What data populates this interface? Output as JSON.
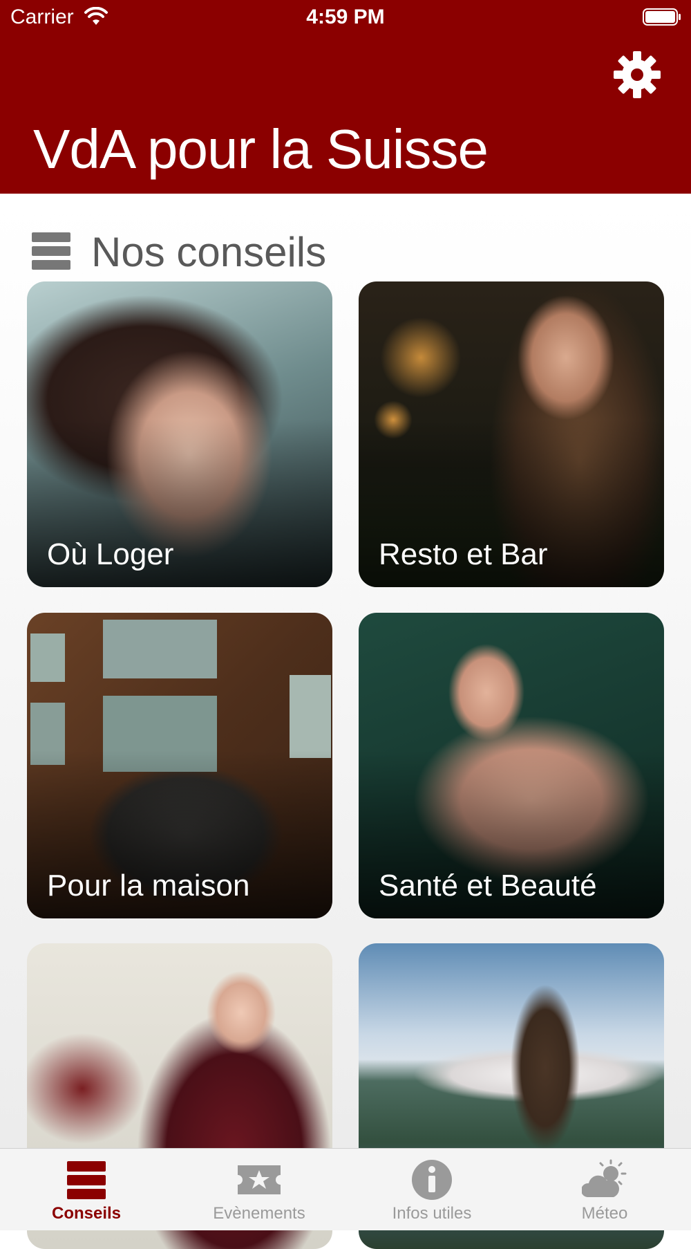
{
  "status_bar": {
    "carrier": "Carrier",
    "time": "4:59 PM"
  },
  "header": {
    "title": "VdA pour la Suisse",
    "settings_icon": "gear-icon"
  },
  "section": {
    "title": "Nos conseils",
    "icon": "list-icon"
  },
  "cards": [
    {
      "label": "Où Loger"
    },
    {
      "label": "Resto et Bar"
    },
    {
      "label": "Pour la maison"
    },
    {
      "label": "Santé et Beauté"
    },
    {
      "label": ""
    },
    {
      "label": ""
    }
  ],
  "tabs": [
    {
      "label": "Conseils",
      "icon": "list-icon",
      "active": true
    },
    {
      "label": "Evènements",
      "icon": "star-ticket-icon",
      "active": false
    },
    {
      "label": "Infos utiles",
      "icon": "info-icon",
      "active": false
    },
    {
      "label": "Méteo",
      "icon": "weather-icon",
      "active": false
    }
  ],
  "colors": {
    "brand": "#8b0000",
    "tab_inactive": "#9a9a9a",
    "section_text": "#595959"
  }
}
